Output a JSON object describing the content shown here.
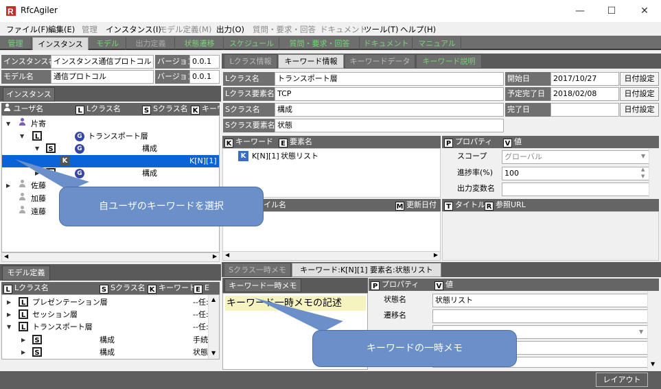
{
  "window": {
    "title": "RfcAgiler",
    "minimize_glyph": "—",
    "maximize_glyph": "☐",
    "close_glyph": "✕"
  },
  "menu": [
    {
      "label": "ファイル(F)",
      "enabled": true
    },
    {
      "label": "編集(E)",
      "enabled": true
    },
    {
      "label": "管理",
      "enabled": false
    },
    {
      "label": "インスタンス(I)",
      "enabled": true
    },
    {
      "label": "モデル定義(M)",
      "enabled": false
    },
    {
      "label": "出力(O)",
      "enabled": true
    },
    {
      "label": "質問・要求・回答",
      "enabled": false
    },
    {
      "label": "ドキュメント",
      "enabled": false
    },
    {
      "label": "ツール(T)",
      "enabled": true
    },
    {
      "label": "ヘルプ(H)",
      "enabled": true
    }
  ],
  "toolbar_tabs": [
    "管理",
    "インスタンス",
    "モデル",
    "出力定義",
    "状態遷移",
    "スケジュール",
    "質問・要求・回答",
    "ドキュメント",
    "マニュアル"
  ],
  "instance": {
    "name_label": "インスタンス名",
    "name_value": "インスタンス通信プロトコル",
    "version_label": "バージョン",
    "version_value": "0.0.1",
    "model_label": "モデル名",
    "model_value": "通信プロトコル",
    "model_version_label": "バージョン",
    "model_version_value": "0.0.1"
  },
  "instance_tree": {
    "tab": "インスタンス",
    "columns": [
      "ユーザ名",
      "Lクラス名",
      "Sクラス名",
      "キーワ"
    ],
    "badges": {
      "l": "L",
      "s": "S",
      "k": "K",
      "e": "E",
      "g": "G",
      "p": "P",
      "v": "V",
      "m": "M",
      "t": "T",
      "r": "R"
    },
    "user1": "片寄",
    "l_class": "トランスポート層",
    "s_class": "構成",
    "keyword": "K[N][1]",
    "s_class2": "構成",
    "others": [
      "佐藤",
      "加藤",
      "遠藤"
    ]
  },
  "detail_tabs": [
    "Lクラス情報",
    "キーワード情報",
    "キーワードデータ",
    "キーワード説明"
  ],
  "detail": {
    "l_class_label": "Lクラス名",
    "l_class_value": "トランスポート層",
    "l_elem_label": "Lクラス要素名",
    "l_elem_value": "TCP",
    "s_class_label": "Sクラス名",
    "s_class_value": "構成",
    "s_elem_label": "Sクラス要素名",
    "s_elem_value": "状態",
    "start_label": "開始日",
    "start_value": "2017/10/27",
    "plan_label": "予定完了日",
    "plan_value": "2018/02/08",
    "done_label": "完了日",
    "done_value": "",
    "date_btn": "日付設定"
  },
  "keyword_list": {
    "col1": "キーワード",
    "col2": "要素名",
    "row_keyword": "K[N][1]",
    "row_elem": "状態リスト"
  },
  "property_top": {
    "col1": "プロパティ",
    "col2": "値",
    "rows": [
      {
        "name": "スコープ",
        "value": "グローバル"
      },
      {
        "name": "進捗率(%)",
        "value": "100"
      },
      {
        "name": "出力変数名",
        "value": ""
      }
    ]
  },
  "file_list": {
    "col1": "イル名",
    "col2": "更新日付",
    "col3": "タイトル",
    "col4": "参照URL"
  },
  "memo_tabs": [
    "Sクラス一時メモ",
    "キーワード:K[N][1] 要素名:状態リスト"
  ],
  "memo": {
    "subtab": "キーワード一時メモ",
    "text": "キーワード一時メモの記述"
  },
  "property_bottom": {
    "col1": "プロパティ",
    "col2": "値",
    "rows": [
      {
        "name": "状態名",
        "value": "状態リスト"
      },
      {
        "name": "遷移名",
        "value": ""
      }
    ]
  },
  "model_tree": {
    "tab": "モデル定義",
    "columns": [
      "Lクラス名",
      "Sクラス名",
      "キーワード",
      "E"
    ],
    "rows": [
      {
        "name": "プレゼンテーション層",
        "suffix": "--任:"
      },
      {
        "name": "セッション層",
        "suffix": "--任:"
      },
      {
        "name": "トランスポート層",
        "suffix": "--任:"
      }
    ],
    "subrows": [
      {
        "s": "構成",
        "suffix": "手続"
      },
      {
        "s": "構成",
        "suffix": "状態"
      }
    ]
  },
  "callouts": {
    "a": "自ユーザのキーワードを選択",
    "b": "キーワードの一時メモ"
  },
  "status": {
    "layout_button": "レイアウト"
  },
  "colors": {
    "accent_green": "#77d477",
    "callout": "#6b8fc9",
    "selection": "#0a64d8",
    "header_gray": "#656565"
  }
}
